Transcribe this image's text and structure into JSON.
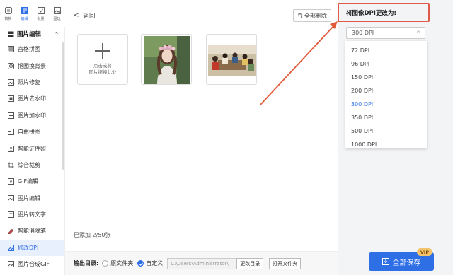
{
  "topbar": {
    "items": [
      {
        "label": "转换",
        "icon": "convert-icon"
      },
      {
        "label": "编辑",
        "icon": "edit-icon"
      },
      {
        "label": "批量",
        "icon": "batch-icon"
      },
      {
        "label": "图玩",
        "icon": "image-icon"
      }
    ]
  },
  "sidebar": {
    "section": "图片编辑",
    "items": [
      {
        "label": "宫格拼图",
        "icon": "grid-icon"
      },
      {
        "label": "抠图换背景",
        "icon": "cutout-icon"
      },
      {
        "label": "照片修复",
        "icon": "repair-icon"
      },
      {
        "label": "图片去水印",
        "icon": "remove-watermark-icon"
      },
      {
        "label": "图片加水印",
        "icon": "add-watermark-icon"
      },
      {
        "label": "自由拼图",
        "icon": "collage-icon"
      },
      {
        "label": "智能证件照",
        "icon": "id-photo-icon"
      },
      {
        "label": "综合裁剪",
        "icon": "crop-icon"
      },
      {
        "label": "GIF编辑",
        "icon": "gif-icon"
      },
      {
        "label": "图片编辑",
        "icon": "image-edit-icon"
      },
      {
        "label": "图片转文字",
        "icon": "ocr-icon"
      },
      {
        "label": "智能消除笔",
        "icon": "eraser-icon"
      },
      {
        "label": "修改DPI",
        "icon": "dpi-icon"
      },
      {
        "label": "图片合成GIF",
        "icon": "gif-compose-icon"
      }
    ]
  },
  "main": {
    "back_label": "返回",
    "delete_all_label": "全部删除",
    "add_tile_hint_line1": "点击或将",
    "add_tile_hint_line2": "图片拖拽此处",
    "count_text": "已添加 2/50张",
    "output_label": "输出目录:",
    "option_original": "原文件夹",
    "option_custom": "自定义",
    "path_value": "C:\\Users\\Administrator\\",
    "change_dir_label": "更改目录",
    "open_folder_label": "打开文件夹"
  },
  "right": {
    "title": "将图像DPI更改为:",
    "selected": "300 DPI",
    "options": [
      "72 DPI",
      "96 DPI",
      "150 DPI",
      "200 DPI",
      "300 DPI",
      "350 DPI",
      "500 DPI",
      "1000 DPI"
    ],
    "save_label": "全部保存",
    "vip_badge": "VIP"
  },
  "colors": {
    "accent": "#2f6fe6",
    "highlight_border": "#e05a4a",
    "vip": "#f2c36b"
  }
}
